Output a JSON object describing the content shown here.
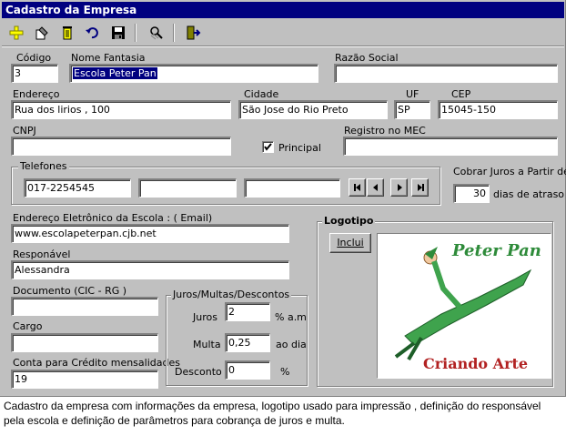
{
  "window": {
    "title": "Cadastro da Empresa"
  },
  "toolbar": {
    "buttons": [
      {
        "icon": "add-icon"
      },
      {
        "icon": "edit-icon"
      },
      {
        "icon": "delete-icon"
      },
      {
        "icon": "undo-icon"
      },
      {
        "icon": "save-icon"
      },
      {
        "icon": "search-icon"
      },
      {
        "icon": "exit-icon"
      }
    ]
  },
  "form": {
    "codigo": {
      "label": "Código",
      "value": "3"
    },
    "nome_fantasia": {
      "label": "Nome Fantasia",
      "value": "Escola Peter Pan"
    },
    "razao_social": {
      "label": "Razão Social",
      "value": ""
    },
    "endereco": {
      "label": "Endereço",
      "value": "Rua dos lirios , 100"
    },
    "cidade": {
      "label": "Cidade",
      "value": "São Jose do Rio Preto"
    },
    "uf": {
      "label": "UF",
      "value": "SP"
    },
    "cep": {
      "label": "CEP",
      "value": "15045-150"
    },
    "cnpj": {
      "label": "CNPJ",
      "value": ""
    },
    "principal": {
      "label": "Principal",
      "checked": true
    },
    "registro_mec": {
      "label": "Registro no MEC",
      "value": ""
    },
    "telefones": {
      "label": "Telefones",
      "values": [
        "017-2254545",
        "",
        ""
      ]
    },
    "cobrar_juros": {
      "label": "Cobrar Juros a Partir de",
      "value": "30",
      "suffix": "dias de atraso"
    },
    "email": {
      "label": "Endereço Eletrônico da Escola : ( Email)",
      "value": "www.escolapeterpan.cjb.net"
    },
    "responsavel": {
      "label": "Responável",
      "value": "Alessandra"
    },
    "documento": {
      "label": "Documento (CIC - RG )",
      "value": ""
    },
    "cargo": {
      "label": "Cargo",
      "value": ""
    },
    "conta_credito": {
      "label": "Conta para Crédito mensalidades",
      "value": "19"
    },
    "juros_group": {
      "title": "Juros/Multas/Descontos",
      "juros": {
        "label": "Juros",
        "value": "2",
        "unit": "% a.m"
      },
      "multa": {
        "label": "Multa",
        "value": "0,25",
        "unit": "ao dia"
      },
      "desconto": {
        "label": "Desconto",
        "value": "0",
        "unit": "%"
      }
    },
    "logotipo": {
      "title": "Logotipo",
      "button": "Inclui",
      "logo_text_top": "Peter Pan",
      "logo_text_bottom": "Criando Arte"
    }
  },
  "caption": "Cadastro da empresa com informações da empresa, logotipo usado para impressão , definição do responsável pela escola e definição de parâmetros para cobrança de juros e multa.",
  "colors": {
    "titlebar": "#000080",
    "face": "#c0c0c0",
    "logo_green": "#2e8b3a",
    "logo_red": "#b22222"
  }
}
